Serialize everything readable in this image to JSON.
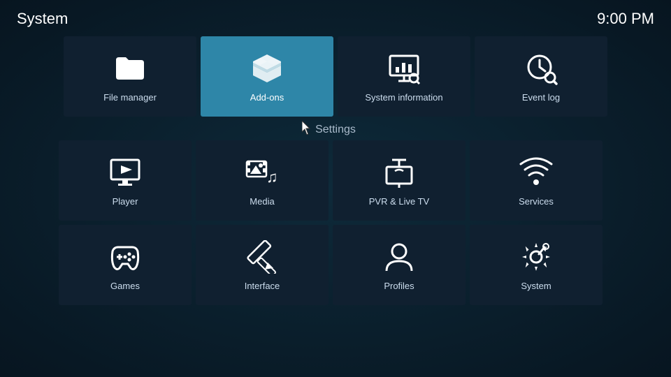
{
  "header": {
    "title": "System",
    "clock": "9:00 PM"
  },
  "top_tiles": [
    {
      "id": "file-manager",
      "label": "File manager",
      "icon": "folder"
    },
    {
      "id": "add-ons",
      "label": "Add-ons",
      "icon": "addons",
      "active": true
    },
    {
      "id": "system-information",
      "label": "System information",
      "icon": "sysinfo"
    },
    {
      "id": "event-log",
      "label": "Event log",
      "icon": "eventlog"
    }
  ],
  "settings_label": "Settings",
  "settings_tiles_row1": [
    {
      "id": "player",
      "label": "Player",
      "icon": "player"
    },
    {
      "id": "media",
      "label": "Media",
      "icon": "media"
    },
    {
      "id": "pvr-live-tv",
      "label": "PVR & Live TV",
      "icon": "pvr"
    },
    {
      "id": "services",
      "label": "Services",
      "icon": "services"
    }
  ],
  "settings_tiles_row2": [
    {
      "id": "games",
      "label": "Games",
      "icon": "games"
    },
    {
      "id": "interface",
      "label": "Interface",
      "icon": "interface"
    },
    {
      "id": "profiles",
      "label": "Profiles",
      "icon": "profiles"
    },
    {
      "id": "system-settings",
      "label": "System",
      "icon": "system"
    }
  ]
}
